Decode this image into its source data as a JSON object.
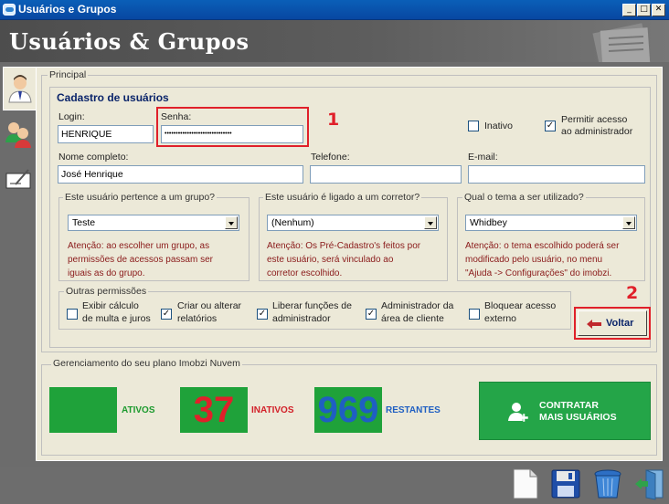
{
  "window": {
    "title": "Usuários e Grupos",
    "minimize": "_",
    "maximize": "□",
    "close": "✕"
  },
  "banner": {
    "title": "Usuários & Grupos"
  },
  "sidebar": {
    "tabs": [
      {
        "icon": "user-icon"
      },
      {
        "icon": "group-icon"
      },
      {
        "icon": "edit-form-icon"
      }
    ]
  },
  "main": {
    "group_label": "Principal",
    "cadastro": {
      "heading": "Cadastro de usuários",
      "login_label": "Login:",
      "login_value": "HENRIQUE",
      "senha_label": "Senha:",
      "senha_value": "••••••••••••••••••••••••••••••",
      "inativo_label": "Inativo",
      "inativo_checked": false,
      "permitir_label_1": "Permitir acesso",
      "permitir_label_2": "ao administrador",
      "permitir_checked": true,
      "nome_label": "Nome completo:",
      "nome_value": "José Henrique",
      "telefone_label": "Telefone:",
      "telefone_value": "",
      "email_label": "E-mail:",
      "email_value": "",
      "grupo": {
        "legend": "Este usuário pertence a um grupo?",
        "selected": "Teste",
        "warn_1": "Atenção: ao escolher um grupo, as",
        "warn_2": "permissões de acessos passam ser",
        "warn_3": "iguais as do grupo."
      },
      "corretor": {
        "legend": "Este usuário é ligado a um corretor?",
        "selected": "(Nenhum)",
        "warn_1": "Atenção: Os Pré-Cadastro's feitos por",
        "warn_2": "este usuário, será vinculado ao",
        "warn_3": "corretor escolhido."
      },
      "tema": {
        "legend": "Qual o tema a ser utilizado?",
        "selected": "Whidbey",
        "warn_1": "Atenção: o tema escolhido poderá ser",
        "warn_2": "modificado pelo usuário, no menu",
        "warn_3": "\"Ajuda -> Configurações\" do imobzi."
      },
      "outras": {
        "legend": "Outras permissões",
        "items": [
          {
            "l1": "Exibir cálculo",
            "l2": "de multa e juros",
            "checked": false
          },
          {
            "l1": "Criar ou alterar",
            "l2": "relatórios",
            "checked": true
          },
          {
            "l1": "Liberar funções de",
            "l2": "administrador",
            "checked": true
          },
          {
            "l1": "Administrador da",
            "l2": "área de cliente",
            "checked": true
          },
          {
            "l1": "Bloquear acesso",
            "l2": "externo",
            "checked": false
          }
        ]
      },
      "voltar_label": "Voltar"
    },
    "annotations": {
      "mark_1": "1",
      "mark_2": "2"
    }
  },
  "plano": {
    "legend": "Gerenciamento do seu plano Imobzi Nuvem",
    "ativos_value": "",
    "ativos_label": "ATIVOS",
    "inativos_value": "37",
    "inativos_label": "INATIVOS",
    "restantes_value": "969",
    "restantes_label": "RESTANTES",
    "contratar_1": "CONTRATAR",
    "contratar_2": "MAIS USUÁRIOS"
  },
  "toolbar": {
    "icons": [
      "new-document-icon",
      "save-icon",
      "trash-icon",
      "exit-door-icon"
    ]
  },
  "colors": {
    "accent_green": "#24a548",
    "red": "#e0202a",
    "blue": "#1f5fc2",
    "title_blue": "#0a246a"
  }
}
